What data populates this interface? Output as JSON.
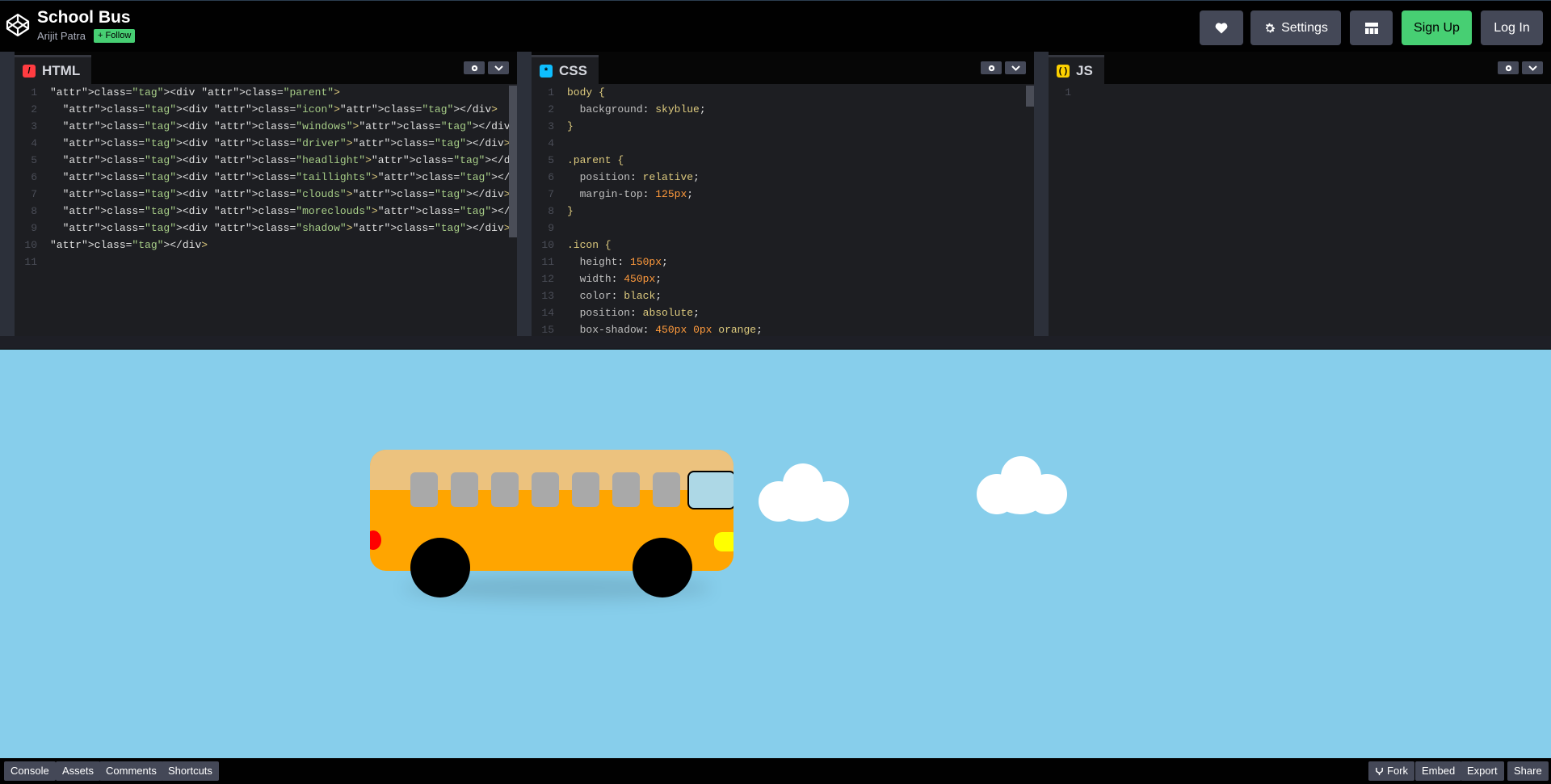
{
  "header": {
    "pen_title": "School Bus",
    "author": "Arijit Patra",
    "follow_label": "+ Follow",
    "settings_label": "Settings",
    "signup_label": "Sign Up",
    "login_label": "Log In",
    "icons": [
      "codepen-logo-icon",
      "heart-icon",
      "gear-icon",
      "layout-grid-icon"
    ]
  },
  "editors": {
    "html": {
      "title": "HTML",
      "icon_color": "#ff3c41",
      "lines": [
        {
          "n": "1",
          "t": "<div class=\"parent\">"
        },
        {
          "n": "2",
          "t": "  <div class=\"icon\"></div>"
        },
        {
          "n": "3",
          "t": "  <div class=\"windows\"></div>"
        },
        {
          "n": "4",
          "t": "  <div class=\"driver\"></div>"
        },
        {
          "n": "5",
          "t": "  <div class=\"headlight\"></div>"
        },
        {
          "n": "6",
          "t": "  <div class=\"taillights\"></div>"
        },
        {
          "n": "7",
          "t": "  <div class=\"clouds\"></div>"
        },
        {
          "n": "8",
          "t": "  <div class=\"moreclouds\"></div>"
        },
        {
          "n": "9",
          "t": "  <div class=\"shadow\"></div>"
        },
        {
          "n": "10",
          "t": "</div>"
        },
        {
          "n": "11",
          "t": ""
        }
      ]
    },
    "css": {
      "title": "CSS",
      "icon_color": "#0ebeff",
      "lines": [
        {
          "n": "1",
          "t": "body {"
        },
        {
          "n": "2",
          "t": "  background: skyblue;"
        },
        {
          "n": "3",
          "t": "}"
        },
        {
          "n": "4",
          "t": ""
        },
        {
          "n": "5",
          "t": ".parent {"
        },
        {
          "n": "6",
          "t": "  position: relative;"
        },
        {
          "n": "7",
          "t": "  margin-top: 125px;"
        },
        {
          "n": "8",
          "t": "}"
        },
        {
          "n": "9",
          "t": ""
        },
        {
          "n": "10",
          "t": ".icon {"
        },
        {
          "n": "11",
          "t": "  height: 150px;"
        },
        {
          "n": "12",
          "t": "  width: 450px;"
        },
        {
          "n": "13",
          "t": "  color: black;"
        },
        {
          "n": "14",
          "t": "  position: absolute;"
        },
        {
          "n": "15",
          "t": "  box-shadow: 450px 0px orange;"
        }
      ]
    },
    "js": {
      "title": "JS",
      "icon_color": "#fcd000",
      "lines": [
        {
          "n": "1",
          "t": ""
        }
      ]
    }
  },
  "preview": {
    "background": "#87ceeb",
    "bus_color": "#ffa500",
    "bus_top_color": "#ecc27e",
    "window_color": "#a9a9a9",
    "driver_window_color": "#add8e6",
    "headlight_color": "#ffff00",
    "taillight_color": "#ff0000"
  },
  "footer": {
    "left": [
      "Console",
      "Assets",
      "Comments",
      "Shortcuts"
    ],
    "fork_label": "Fork",
    "embed_label": "Embed",
    "export_label": "Export",
    "share_label": "Share"
  }
}
